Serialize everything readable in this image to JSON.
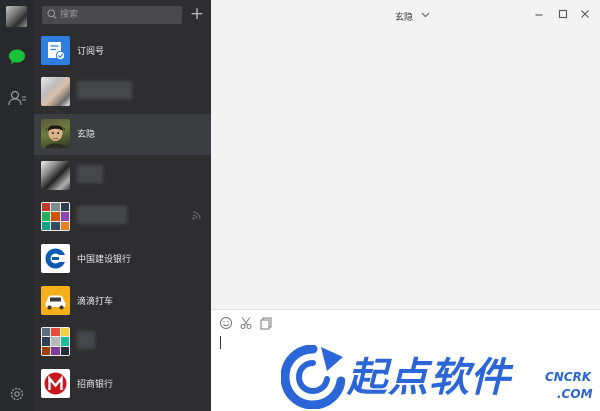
{
  "search": {
    "placeholder": "搜索"
  },
  "nav": {
    "icons": [
      "chat-icon",
      "contacts-icon",
      "settings-icon"
    ],
    "active_color": "#19c339"
  },
  "chats": [
    {
      "name": "订阅号",
      "avatar": "subscription-icon",
      "redacted": false
    },
    {
      "name": "",
      "avatar": "photo",
      "redacted": true
    },
    {
      "name": "玄隐",
      "avatar": "cartoon",
      "redacted": false,
      "selected": true
    },
    {
      "name": "",
      "avatar": "photo",
      "redacted": true
    },
    {
      "name": "",
      "avatar": "group-grid",
      "redacted": true,
      "muted_icon": "rss-icon"
    },
    {
      "name": "中国建设银行",
      "avatar": "ccb-logo",
      "redacted": false
    },
    {
      "name": "滴滴打车",
      "avatar": "didi-logo",
      "redacted": false
    },
    {
      "name": "",
      "avatar": "group-grid",
      "redacted": true
    },
    {
      "name": "招商银行",
      "avatar": "cmb-logo",
      "redacted": false
    }
  ],
  "chat": {
    "title": "玄隐"
  },
  "composer": {
    "tools": [
      "emoji-icon",
      "scissors-icon",
      "file-icon"
    ],
    "text": ""
  },
  "watermark": {
    "brand": "起点软件",
    "domain": "CNCRK",
    "tld": ".COM"
  },
  "colors": {
    "rail": "#28292c",
    "list": "#2e2e30",
    "selected_row": "#3c3d40",
    "chat_bg": "#f3f3f3",
    "watermark": "#2b66d8"
  }
}
